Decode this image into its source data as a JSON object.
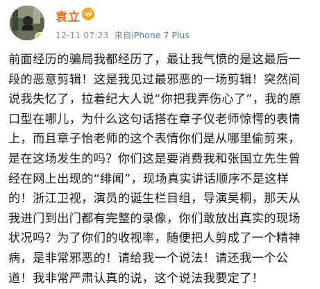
{
  "post": {
    "author": {
      "name": "袁立",
      "avatar_icon": "avatar-photo",
      "verified_badge_icon": "verified-badge-icon",
      "member_icon": "weibo-member-icon",
      "brand_color": "#f76b1c"
    },
    "meta": {
      "timestamp": "12-11 07:23",
      "source_prefix": "来自",
      "device": "iPhone 7 Plus",
      "device_color": "#4a7cb8"
    },
    "text_lines": [
      "前面经历的骗局我都经历了，最让我气愤的是这最后一",
      "段的恶意剪辑！这是我见过最邪恶的一场剪辑！突然间",
      "说我失忆了，拉着纪大人说“你把我弄伤心了”，我的原",
      "口型在哪儿，为什么这句话搭在章子仪老师惊愕的表情",
      "上，而且章子怡老师的这个表情你们是从哪里偷剪来，",
      "是在这场发生的吗？你们这是要消费我和张国立先生曾",
      "经在网上出现的“绯闻”，现场真实讲话顺序不是这样",
      "的！浙江卫视，演员的诞生栏目组，导演吴桐，那天从",
      "我进门到出门都有完整的录像，你们敢放出真实的现场",
      "状况吗？为了你们的收视率，随便把人剪成了一个精神",
      "病，是非常邪恶的！请给我一个说法！请还我一个公",
      "道！我非常严肃认真的说，这个说法我要定了！"
    ]
  }
}
